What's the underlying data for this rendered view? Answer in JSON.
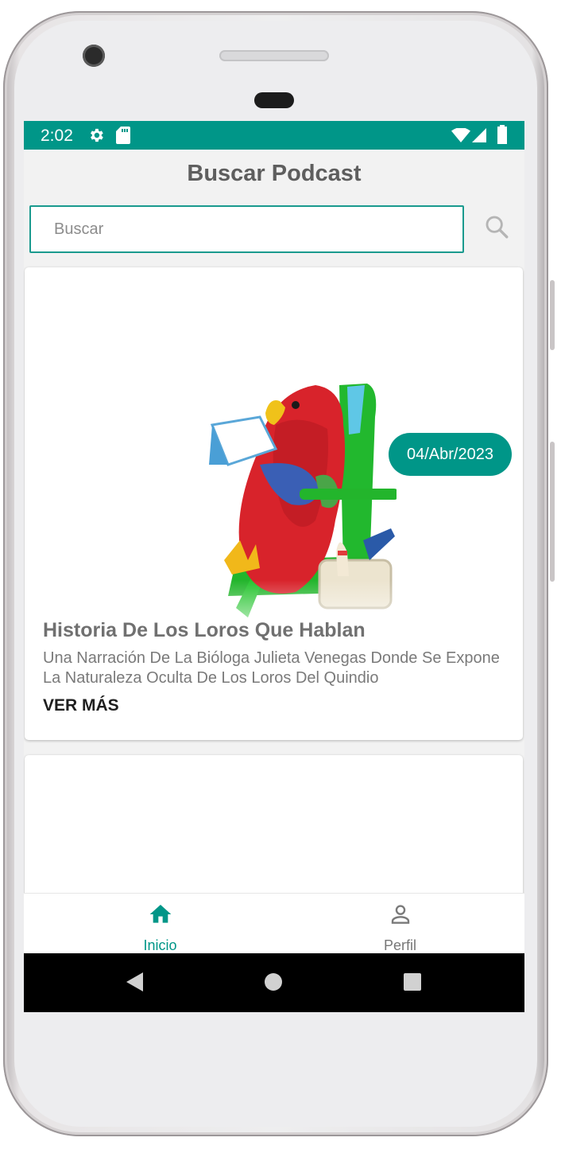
{
  "status_bar": {
    "time": "2:02",
    "icons": [
      "gear-icon",
      "sd-card-icon",
      "wifi-icon",
      "signal-icon",
      "battery-icon"
    ]
  },
  "header": {
    "title": "Buscar Podcast"
  },
  "search": {
    "placeholder": "Buscar",
    "value": ""
  },
  "episodes": [
    {
      "date": "04/Abr/2023",
      "title": "Historia De Los Loros Que Hablan",
      "description": "Una Narración De La Bióloga Julieta Venegas  Donde Se Expone La Naturaleza Oculta De Los Loros Del Quindio",
      "more_label": "VER MÁS",
      "image": "red parrot figurine reading a book in a green chair"
    }
  ],
  "bottom_nav": [
    {
      "label": "Inicio",
      "icon": "home-icon",
      "active": true
    },
    {
      "label": "Perfil",
      "icon": "person-icon",
      "active": false
    }
  ],
  "colors": {
    "accent": "#009688",
    "background": "#f2f2f2",
    "title_text": "#5e5e5e"
  }
}
